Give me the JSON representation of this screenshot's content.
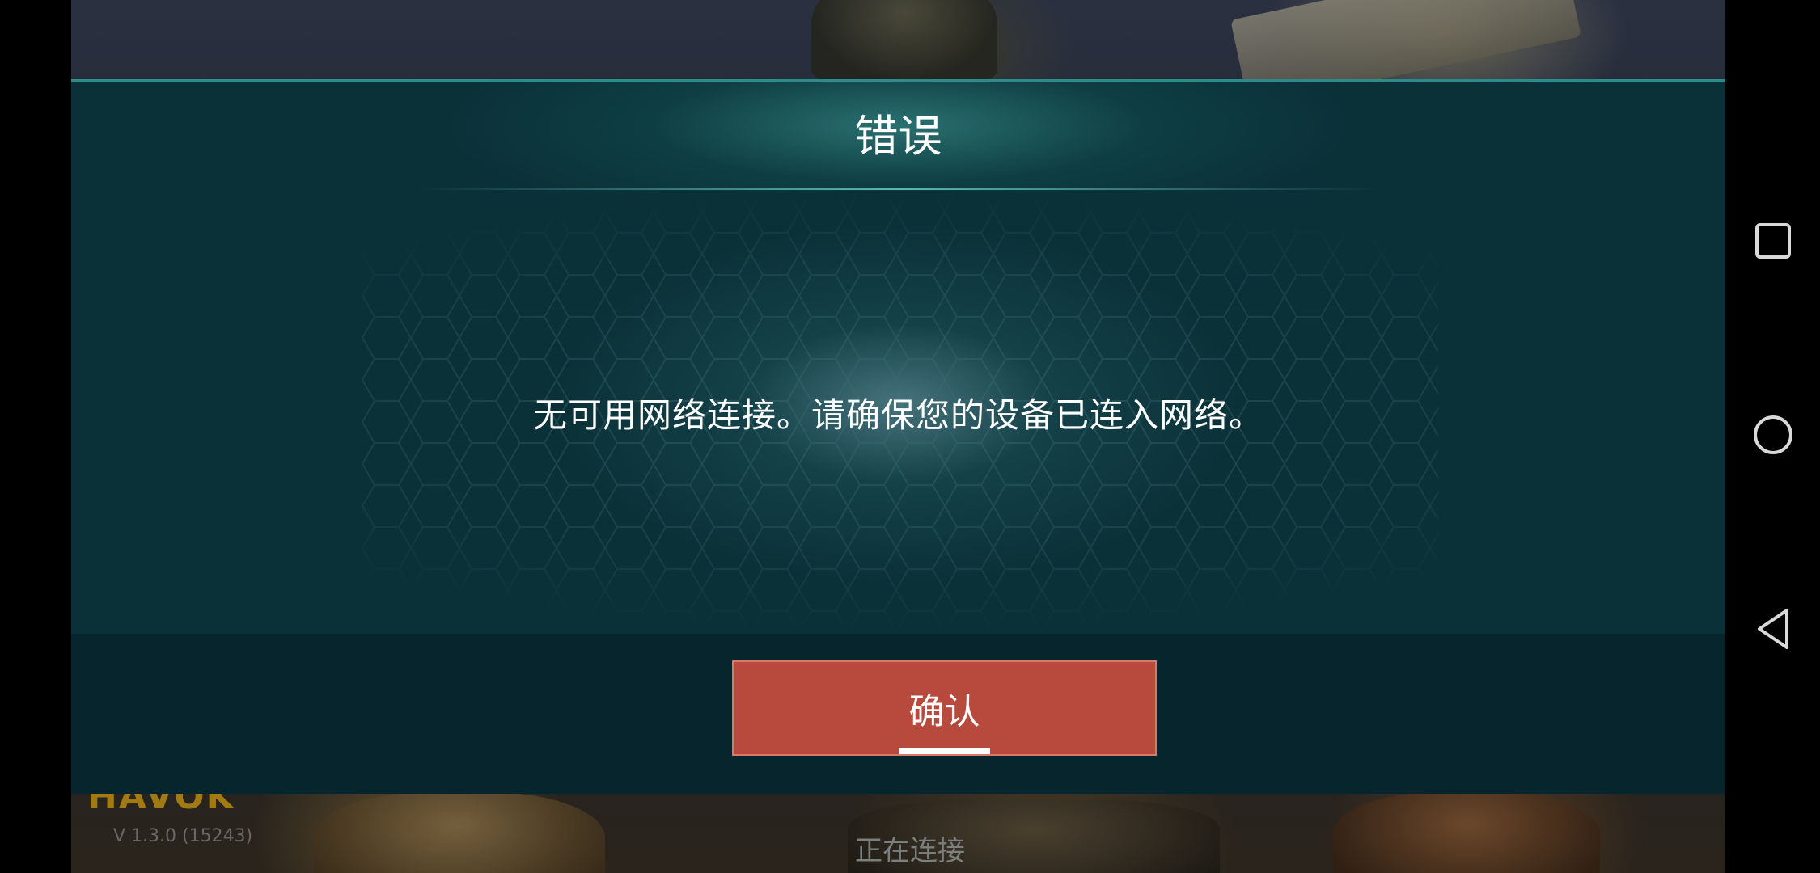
{
  "dialog": {
    "title": "错误",
    "message": "无可用网络连接。请确保您的设备已连入网络。",
    "confirm_label": "确认"
  },
  "background": {
    "logo_text": "HAVOK",
    "version_text": "V 1.3.0 (15243)",
    "status_text": "正在连接"
  },
  "navbar": {
    "icons": [
      "recent-apps-icon",
      "home-icon",
      "back-icon"
    ]
  },
  "colors": {
    "dialog_bg": "#0b3138",
    "dialog_footer_bg": "#06252c",
    "accent_teal": "#2f8a8a",
    "confirm_button": "#b7493d",
    "text": "#ffffff"
  }
}
